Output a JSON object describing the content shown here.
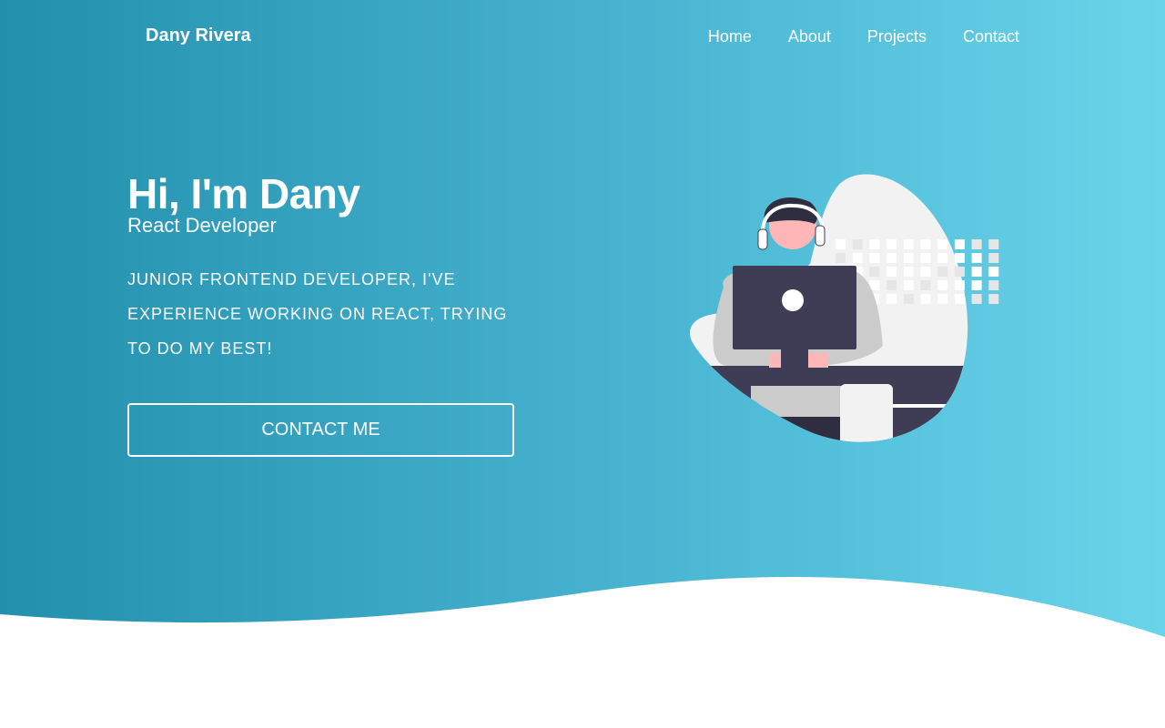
{
  "header": {
    "brand": "Dany Rivera",
    "nav": [
      "Home",
      "About",
      "Projects",
      "Contact"
    ]
  },
  "hero": {
    "title": "Hi, I'm Dany",
    "subtitle": "React Developer",
    "description": "Junior frontend developer, I've experience working on React, trying to do my best!",
    "cta": "CONTACT ME"
  },
  "colors": {
    "gradient_start": "#2290ad",
    "gradient_end": "#6ad4ea",
    "illustration_dark": "#3f3d56",
    "skin": "#ffb6b6"
  },
  "illustration": "developer-at-computer-with-headphones"
}
